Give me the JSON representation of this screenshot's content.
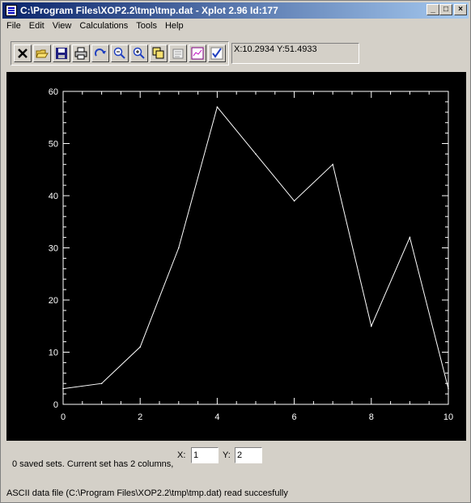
{
  "window": {
    "title": "C:\\Program Files\\XOP2.2\\tmp\\tmp.dat - Xplot 2.96 Id:177"
  },
  "menubar": {
    "items": [
      "File",
      "Edit",
      "View",
      "Calculations",
      "Tools",
      "Help"
    ]
  },
  "toolbar": {
    "buttons": [
      "close-icon",
      "open-folder-icon",
      "save-icon",
      "print-icon",
      "redo-icon",
      "zoom-out-icon",
      "zoom-in-icon",
      "copy-icon",
      "properties-icon",
      "chart-icon",
      "check-icon"
    ]
  },
  "coord_readout": "X:10.2934 Y:51.4933",
  "status": {
    "sets_text": "0  saved sets. Current set has  2  columns,",
    "x_label": "X:",
    "x_value": "1",
    "y_label": "Y:",
    "y_value": "2",
    "message": "ASCII data file (C:\\Program Files\\XOP2.2\\tmp\\tmp.dat) read succesfully"
  },
  "chart_data": {
    "type": "line",
    "x": [
      0,
      1,
      2,
      3,
      4,
      5,
      6,
      7,
      8,
      9,
      10
    ],
    "values": [
      3,
      4,
      11,
      30,
      57,
      48,
      39,
      46,
      15,
      32,
      3
    ],
    "xlim": [
      0,
      10
    ],
    "ylim": [
      0,
      60
    ],
    "xticks": [
      "0",
      "2",
      "4",
      "6",
      "8",
      "10"
    ],
    "yticks": [
      "0",
      "10",
      "20",
      "30",
      "40",
      "50",
      "60"
    ],
    "background": "#000000",
    "line_color": "#ffffff"
  }
}
